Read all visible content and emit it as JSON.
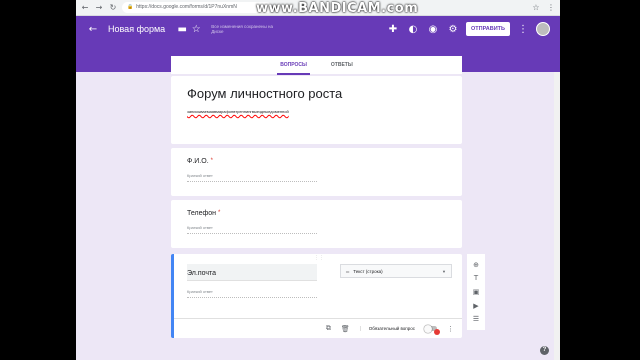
{
  "browser": {
    "url": "https://docs.google.com/forms/d/1P7nuXnmN",
    "secure_label": "🔒",
    "watermark": "www.BANDICAM.com"
  },
  "header": {
    "form_name": "Новая форма",
    "save_note": "Все изменения сохранены на Диске",
    "send_label": "ОТПРАВИТЬ"
  },
  "tabs": [
    {
      "label": "ВОПРОСЫ",
      "active": true
    },
    {
      "label": "ОТВЕТЫ",
      "active": false
    }
  ],
  "form": {
    "title": "Форум личностного роста",
    "description": "записываемаявмарафонвтреннингвыездныедоменной"
  },
  "questions": [
    {
      "title": "Ф.И.О.",
      "required_mark": "*",
      "answer_placeholder": "Краткий ответ"
    },
    {
      "title": "Телефон",
      "required_mark": "*",
      "answer_placeholder": "Краткий ответ"
    },
    {
      "title": "Эл.почта",
      "answer_placeholder": "Краткий ответ",
      "type": "Текст (строка)",
      "required_label": "Обязательный вопрос",
      "drag_handle": "⋮⋮"
    }
  ],
  "icons": {
    "back": "arrow-left-icon",
    "folder": "folder-icon",
    "star": "star-icon",
    "addons": "puzzle-icon",
    "palette": "palette-icon",
    "preview": "eye-icon",
    "settings": "gear-icon"
  },
  "colors": {
    "accent": "#673ab7",
    "background": "#ede7f6",
    "active_border": "#4285f4"
  }
}
